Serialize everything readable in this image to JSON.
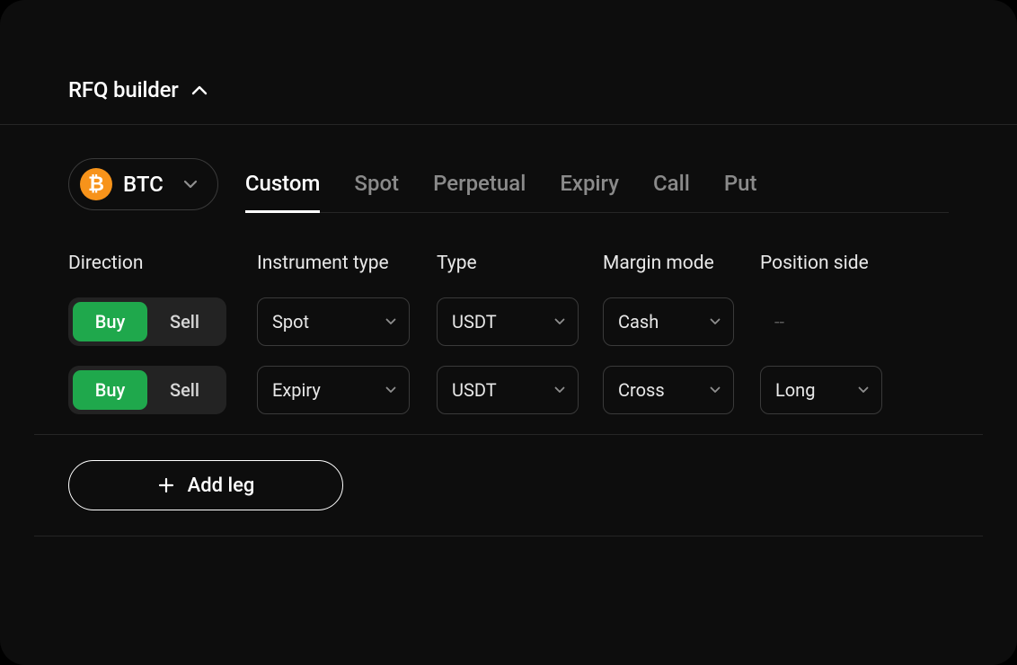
{
  "header": {
    "title": "RFQ builder"
  },
  "asset": {
    "symbol": "BTC",
    "icon_glyph": "₿"
  },
  "tabs": [
    {
      "label": "Custom",
      "active": true
    },
    {
      "label": "Spot",
      "active": false
    },
    {
      "label": "Perpetual",
      "active": false
    },
    {
      "label": "Expiry",
      "active": false
    },
    {
      "label": "Call",
      "active": false
    },
    {
      "label": "Put",
      "active": false
    }
  ],
  "columns": {
    "direction": "Direction",
    "instrument": "Instrument type",
    "type": "Type",
    "margin": "Margin mode",
    "position": "Position side"
  },
  "legs": [
    {
      "direction": {
        "buy": "Buy",
        "sell": "Sell",
        "active": "buy"
      },
      "instrument": "Spot",
      "type": "USDT",
      "margin": "Cash",
      "position": "--",
      "position_is_placeholder": true
    },
    {
      "direction": {
        "buy": "Buy",
        "sell": "Sell",
        "active": "buy"
      },
      "instrument": "Expiry",
      "type": "USDT",
      "margin": "Cross",
      "position": "Long",
      "position_is_placeholder": false
    }
  ],
  "add_leg": {
    "label": "Add leg"
  }
}
